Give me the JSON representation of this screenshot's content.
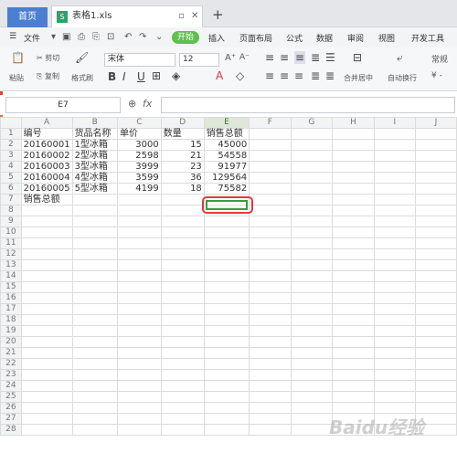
{
  "tabs": {
    "home": "首页",
    "file": "表格1.xls"
  },
  "menubar": {
    "file_menu": "文件",
    "start": "开始",
    "items": [
      "插入",
      "页面布局",
      "公式",
      "数据",
      "审阅",
      "视图",
      "开发工具"
    ]
  },
  "ribbon": {
    "paste": "粘贴",
    "cut": "剪切",
    "copy": "复制",
    "format_painter": "格式刷",
    "font": "宋体",
    "size": "12",
    "merge": "合并居中",
    "wrap": "自动换行",
    "number_format": "常规"
  },
  "formula_bar": {
    "name_box": "E7",
    "fx": "fx"
  },
  "columns": [
    "A",
    "B",
    "C",
    "D",
    "E",
    "F",
    "G",
    "H",
    "I",
    "J"
  ],
  "rows": [
    [
      "编号",
      "货品名称",
      "单价",
      "数量",
      "销售总额"
    ],
    [
      "20160001",
      "1型冰箱",
      "3000",
      "15",
      "45000"
    ],
    [
      "20160002",
      "2型冰箱",
      "2598",
      "21",
      "54558"
    ],
    [
      "20160003",
      "3型冰箱",
      "3999",
      "23",
      "91977"
    ],
    [
      "20160004",
      "4型冰箱",
      "3599",
      "36",
      "129564"
    ],
    [
      "20160005",
      "5型冰箱",
      "4199",
      "18",
      "75582"
    ],
    [
      "销售总额",
      "",
      "",
      "",
      ""
    ]
  ],
  "row_count": 28,
  "watermark": "Baidu经验"
}
